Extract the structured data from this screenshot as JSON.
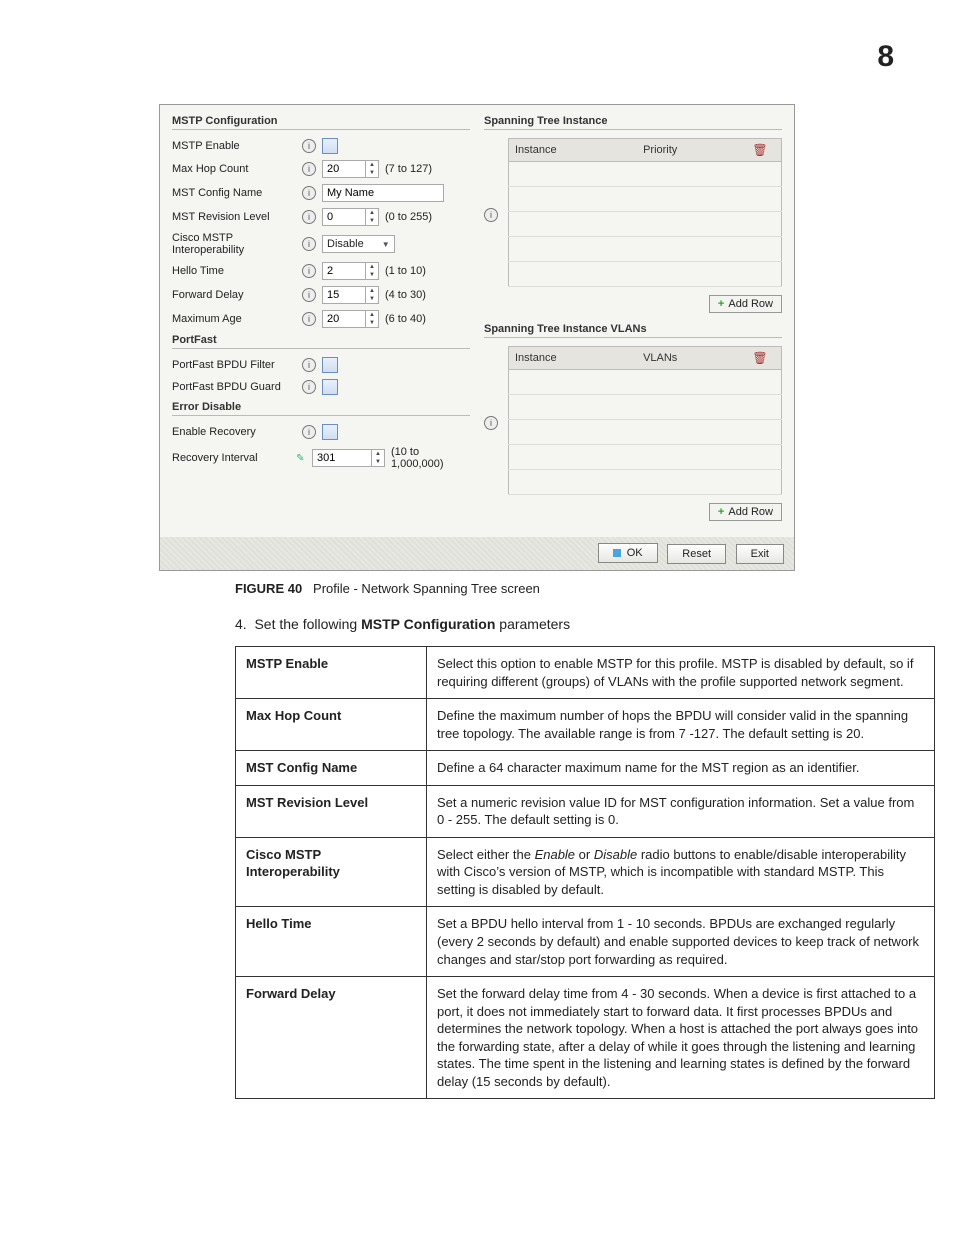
{
  "page_number": "8",
  "panel": {
    "mstp": {
      "title": "MSTP Configuration",
      "fields": {
        "enable": "MSTP Enable",
        "maxhop": "Max Hop Count",
        "maxhop_val": "20",
        "maxhop_hint": "(7 to 127)",
        "cfgname": "MST Config Name",
        "cfgname_val": "My Name",
        "rev": "MST Revision Level",
        "rev_val": "0",
        "rev_hint": "(0 to 255)",
        "cisco": "Cisco MSTP Interoperability",
        "cisco_val": "Disable",
        "hello": "Hello Time",
        "hello_val": "2",
        "hello_hint": "(1 to 10)",
        "fwd": "Forward Delay",
        "fwd_val": "15",
        "fwd_hint": "(4 to 30)",
        "maxage": "Maximum Age",
        "maxage_val": "20",
        "maxage_hint": "(6 to 40)"
      }
    },
    "portfast": {
      "title": "PortFast",
      "filter": "PortFast BPDU Filter",
      "guard": "PortFast BPDU Guard"
    },
    "errd": {
      "title": "Error Disable",
      "enable": "Enable Recovery",
      "interval": "Recovery Interval",
      "interval_val": "301",
      "interval_hint": "(10 to 1,000,000)"
    },
    "sti": {
      "title": "Spanning Tree Instance",
      "col1": "Instance",
      "col2": "Priority"
    },
    "stiv": {
      "title": "Spanning Tree Instance VLANs",
      "col1": "Instance",
      "col2": "VLANs"
    },
    "addrow": "Add Row",
    "ok": "OK",
    "reset": "Reset",
    "exit": "Exit"
  },
  "caption": {
    "label": "FIGURE 40",
    "text": "Profile - Network Spanning Tree screen"
  },
  "step": {
    "num": "4.",
    "pre": "Set the following ",
    "bold": "MSTP Configuration",
    "post": " parameters"
  },
  "table": [
    {
      "k": "MSTP Enable",
      "v": "Select this option to enable MSTP for this profile. MSTP is disabled by default, so if requiring different (groups) of VLANs with the profile supported network segment."
    },
    {
      "k": "Max Hop Count",
      "v": "Define the maximum number of hops the BPDU will consider valid in the spanning tree topology. The available range is from 7 -127. The default setting is 20."
    },
    {
      "k": "MST Config Name",
      "v": "Define a 64 character maximum name for the MST region as an identifier."
    },
    {
      "k": "MST Revision Level",
      "v": "Set a numeric revision value ID for MST configuration information. Set a value from 0 - 255. The default setting is 0."
    },
    {
      "k": "Cisco MSTP Interoperability",
      "v": "Select either the Enable or Disable radio buttons to enable/disable interoperability with Cisco's version of MSTP, which is incompatible with standard MSTP. This setting is disabled by default."
    },
    {
      "k": "Hello Time",
      "v": "Set a BPDU hello interval from 1 - 10 seconds. BPDUs are exchanged regularly (every 2 seconds by default) and enable supported devices to keep track of network changes and star/stop port forwarding as required."
    },
    {
      "k": "Forward Delay",
      "v": "Set the forward delay time from 4 - 30 seconds. When a device is first attached to a port, it does not immediately start to forward data. It first processes BPDUs and determines the network topology. When a host is attached the port always goes into the forwarding state, after a delay of while it goes through the listening and learning states. The time spent in the listening and learning states is defined by the forward delay (15 seconds by default)."
    }
  ]
}
